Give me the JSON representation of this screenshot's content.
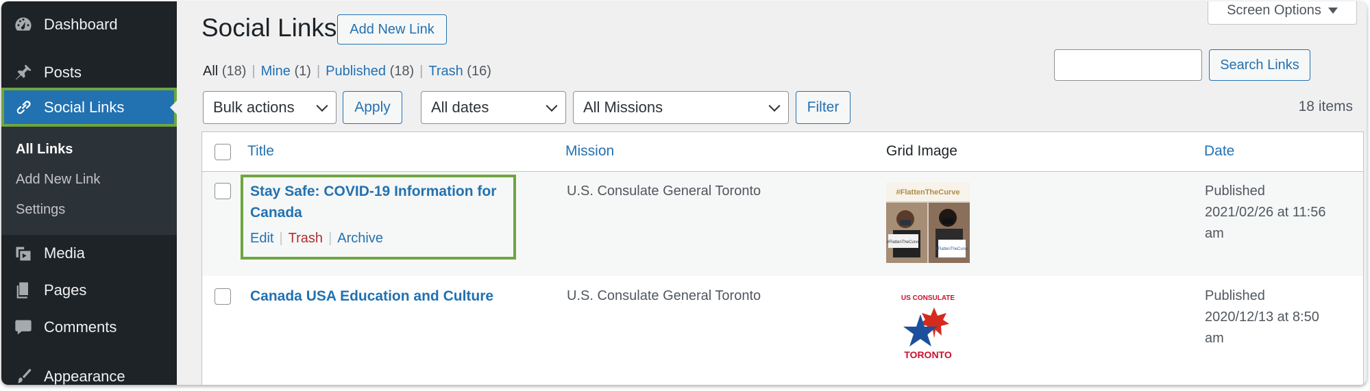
{
  "sidebar": {
    "items": [
      {
        "label": "Dashboard",
        "icon": "dashboard-icon"
      },
      {
        "label": "Posts",
        "icon": "pin-icon"
      },
      {
        "label": "Social Links",
        "icon": "link-icon",
        "active": true
      },
      {
        "label": "Media",
        "icon": "media-icon"
      },
      {
        "label": "Pages",
        "icon": "pages-icon"
      },
      {
        "label": "Comments",
        "icon": "comment-icon"
      },
      {
        "label": "Appearance",
        "icon": "brush-icon"
      }
    ],
    "submenu": [
      {
        "label": "All Links",
        "current": true
      },
      {
        "label": "Add New Link"
      },
      {
        "label": "Settings"
      }
    ]
  },
  "header": {
    "title": "Social Links",
    "add_new_label": "Add New Link",
    "screen_options_label": "Screen Options"
  },
  "views": {
    "all": {
      "label": "All",
      "count": "(18)"
    },
    "mine": {
      "label": "Mine",
      "count": "(1)"
    },
    "published": {
      "label": "Published",
      "count": "(18)"
    },
    "trash": {
      "label": "Trash",
      "count": "(16)"
    },
    "separator": "|"
  },
  "search": {
    "value": "",
    "button_label": "Search Links"
  },
  "filters": {
    "bulk_actions": "Bulk actions",
    "apply_label": "Apply",
    "dates": "All dates",
    "missions": "All Missions",
    "filter_label": "Filter",
    "items_count": "18 items"
  },
  "table": {
    "columns": {
      "title": "Title",
      "mission": "Mission",
      "grid_image": "Grid Image",
      "date": "Date"
    },
    "rows": [
      {
        "title_line1": "Stay Safe: COVID-19 Information for",
        "title_line2": "Canada",
        "actions": {
          "edit": "Edit",
          "trash": "Trash",
          "archive": "Archive"
        },
        "mission": "U.S. Consulate General Toronto",
        "date_status": "Published",
        "date_line1": "2021/02/26 at 11:56",
        "date_line2": "am",
        "image_caption": "#FlattenTheCurve",
        "image_sign_left": "#FlattenTheCurve",
        "image_sign_right": "#FlattenTheCurve"
      },
      {
        "title_line1": "Canada USA Education and Culture",
        "mission": "U.S. Consulate General Toronto",
        "date_status": "Published",
        "date_line1": "2020/12/13 at 8:50",
        "date_line2": "am",
        "logo_top": "US CONSULATE",
        "logo_bottom": "TORONTO"
      }
    ]
  },
  "colors": {
    "sidebar_bg": "#1d2327",
    "accent": "#2271b1",
    "highlight_green": "#6ea63f",
    "trash_red": "#b32d2e"
  }
}
